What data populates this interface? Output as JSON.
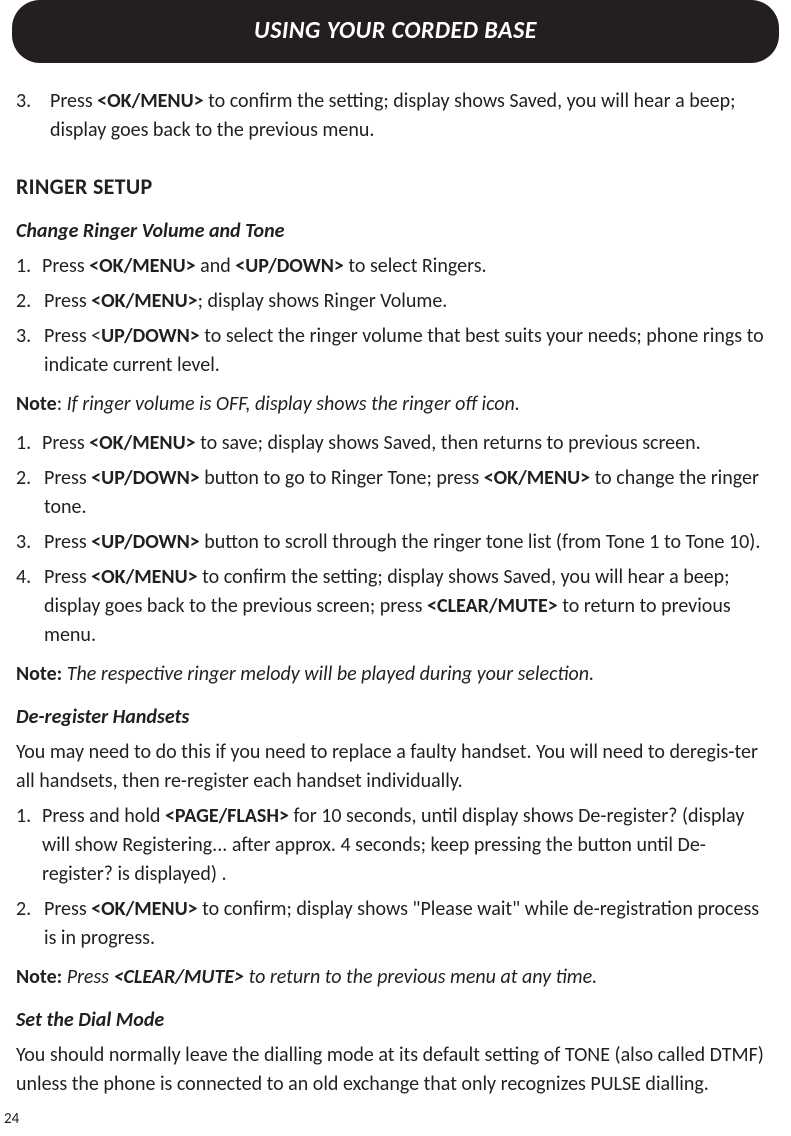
{
  "header": {
    "title": "USING YOUR CORDED BASE"
  },
  "top": {
    "num": "3.",
    "pre": "Press ",
    "btn": "<OK/MENU>",
    "post": " to confirm the setting; display shows Saved, you will hear a beep; display goes back to the previous menu."
  },
  "ringer": {
    "heading": "RINGER SETUP",
    "sub": "Change Ringer Volume and Tone",
    "s1": {
      "num": "1.",
      "pre": "Press ",
      "btn1": "<OK/MENU>",
      "mid": " and ",
      "btn2": "<UP/DOWN>",
      "post": " to select Ringers."
    },
    "s2": {
      "num": "2.",
      "pre": "Press ",
      "btn": "<OK/MENU>",
      "post": "; display shows Ringer Volume."
    },
    "s3": {
      "num": "3.",
      "pre": "Press <",
      "btn": "UP/DOWN>",
      "post": " to select the ringer volume that best suits your needs; phone rings to indicate current level."
    },
    "note1": {
      "label": "Note",
      "colon": ": ",
      "body": "If ringer volume is OFF, display shows the ringer off icon."
    },
    "t1": {
      "num": "1.",
      "pre": "Press ",
      "btn": "<OK/MENU>",
      "post": " to save; display shows Saved, then returns to previous screen."
    },
    "t2": {
      "num": "2.",
      "pre": "Press ",
      "btn1": "<UP/DOWN>",
      "mid": " button to go to Ringer Tone; press ",
      "btn2": "<OK/MENU>",
      "post": " to change the ringer tone."
    },
    "t3": {
      "num": "3.",
      "pre": "Press ",
      "btn": "<UP/DOWN>",
      "post": " button to scroll through the ringer tone list (from Tone 1 to Tone 10)."
    },
    "t4": {
      "num": "4.",
      "pre": "Press ",
      "btn1": "<OK/MENU>",
      "mid": " to confirm the setting; display shows Saved, you will hear a beep; display goes back to the previous screen; press ",
      "btn2": "<CLEAR/MUTE>",
      "post": " to return to previous menu."
    },
    "note2": {
      "label": "Note:",
      "space": " ",
      "body": "The respective ringer melody will be played during your selection."
    }
  },
  "dereg": {
    "sub": "De-register Handsets",
    "intro": "You may need to do this if you need to replace a faulty handset.  You will need to deregis-ter all handsets, then re-register each handset individually.",
    "s1": {
      "num": "1.",
      "pre": "Press and hold ",
      "btn": "<PAGE/FLASH>",
      "post": " for 10 seconds, until display shows De-register? (display will show Registering... after approx. 4 seconds; keep pressing the button until De-register? is displayed) ."
    },
    "s2": {
      "num": "2.",
      "pre": "Press ",
      "btn": "<OK/MENU>",
      "post": " to confirm; display shows \"Please wait\" while de-registration process is in progress."
    },
    "note": {
      "label": "Note:",
      "space": " ",
      "pre": "Press ",
      "btn": "<CLEAR/MUTE>",
      "post": " to return to the previous menu at any time."
    }
  },
  "dial": {
    "sub": "Set the Dial Mode",
    "body": "You should normally leave the dialling mode at its default setting of TONE (also called DTMF) unless the phone is connected to an old exchange that only recognizes PULSE dialling."
  },
  "pagenum": "24"
}
